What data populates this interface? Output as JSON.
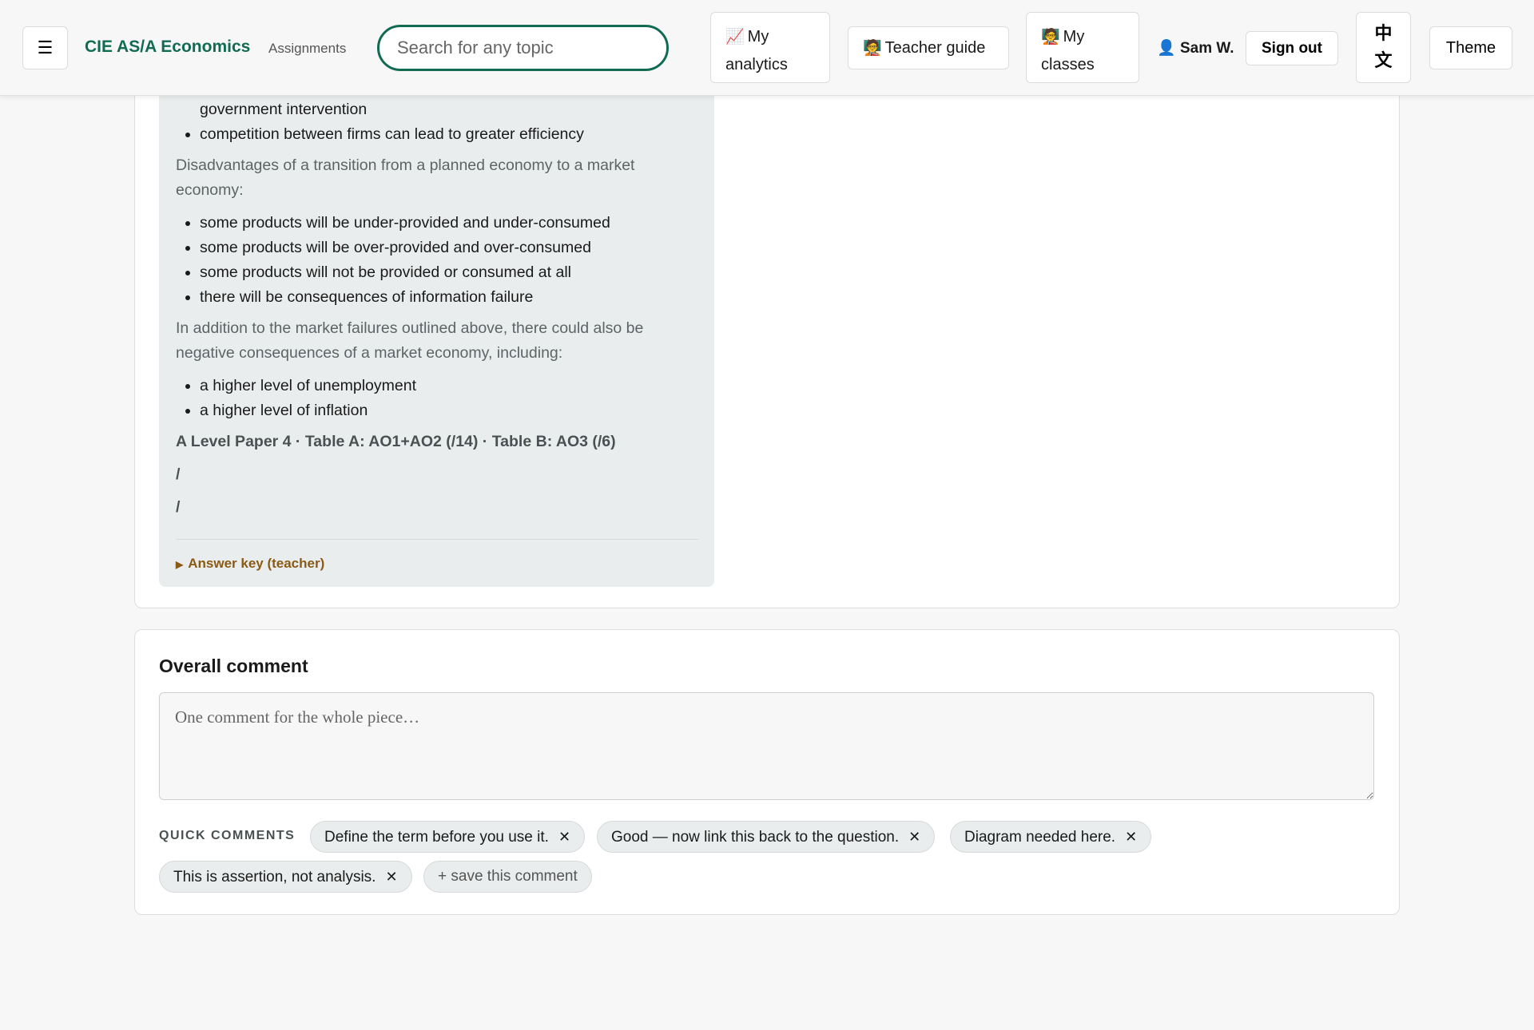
{
  "header": {
    "menu_icon": "☰",
    "brand": "CIE AS/A Economics",
    "subnav": "Assignments",
    "search_placeholder": "Search for any topic",
    "analytics_icon": "📈",
    "analytics_line1": "My",
    "analytics_line2": "analytics",
    "teacher_icon": "🧑‍🏫",
    "teacher_label": "Teacher guide",
    "classes_icon": "🧑‍🏫",
    "classes_line1": "My",
    "classes_line2": "classes",
    "user_icon": "👤",
    "user_name": "Sam W.",
    "signout": "Sign out",
    "lang_line1": "中",
    "lang_line2": "文",
    "theme": "Theme"
  },
  "answer": {
    "list1": [
      "government intervention",
      "competition between firms can lead to greater efficiency"
    ],
    "para1": "Disadvantages of a transition from a planned economy to a market economy:",
    "list2": [
      "some products will be under-provided and under-consumed",
      "some products will be over-provided and over-consumed",
      "some products will not be provided or consumed at all",
      "there will be consequences of information failure"
    ],
    "para2": "In addition to the market failures outlined above, there could also be negative consequences of a market economy, including:",
    "list3": [
      "a higher level of unemployment",
      "a higher level of inflation"
    ],
    "meta": "A Level Paper 4 · Table A: AO1+AO2 (/14) · Table B: AO3 (/6)",
    "slash1": "/",
    "slash2": "/",
    "answer_key_icon": "▶",
    "answer_key": "Answer key (teacher)"
  },
  "comment": {
    "title": "Overall comment",
    "placeholder": "One comment for the whole piece…",
    "quick_label": "QUICK COMMENTS",
    "remove_icon": "✕",
    "chips": [
      "Define the term before you use it.",
      "Good — now link this back to the question.",
      "Diagram needed here.",
      "This is assertion, not analysis."
    ],
    "save_chip": "+ save this comment"
  },
  "colors": {
    "brand": "#116b52",
    "answer_key": "#8a5a14",
    "panel_bg": "#eaeded"
  }
}
